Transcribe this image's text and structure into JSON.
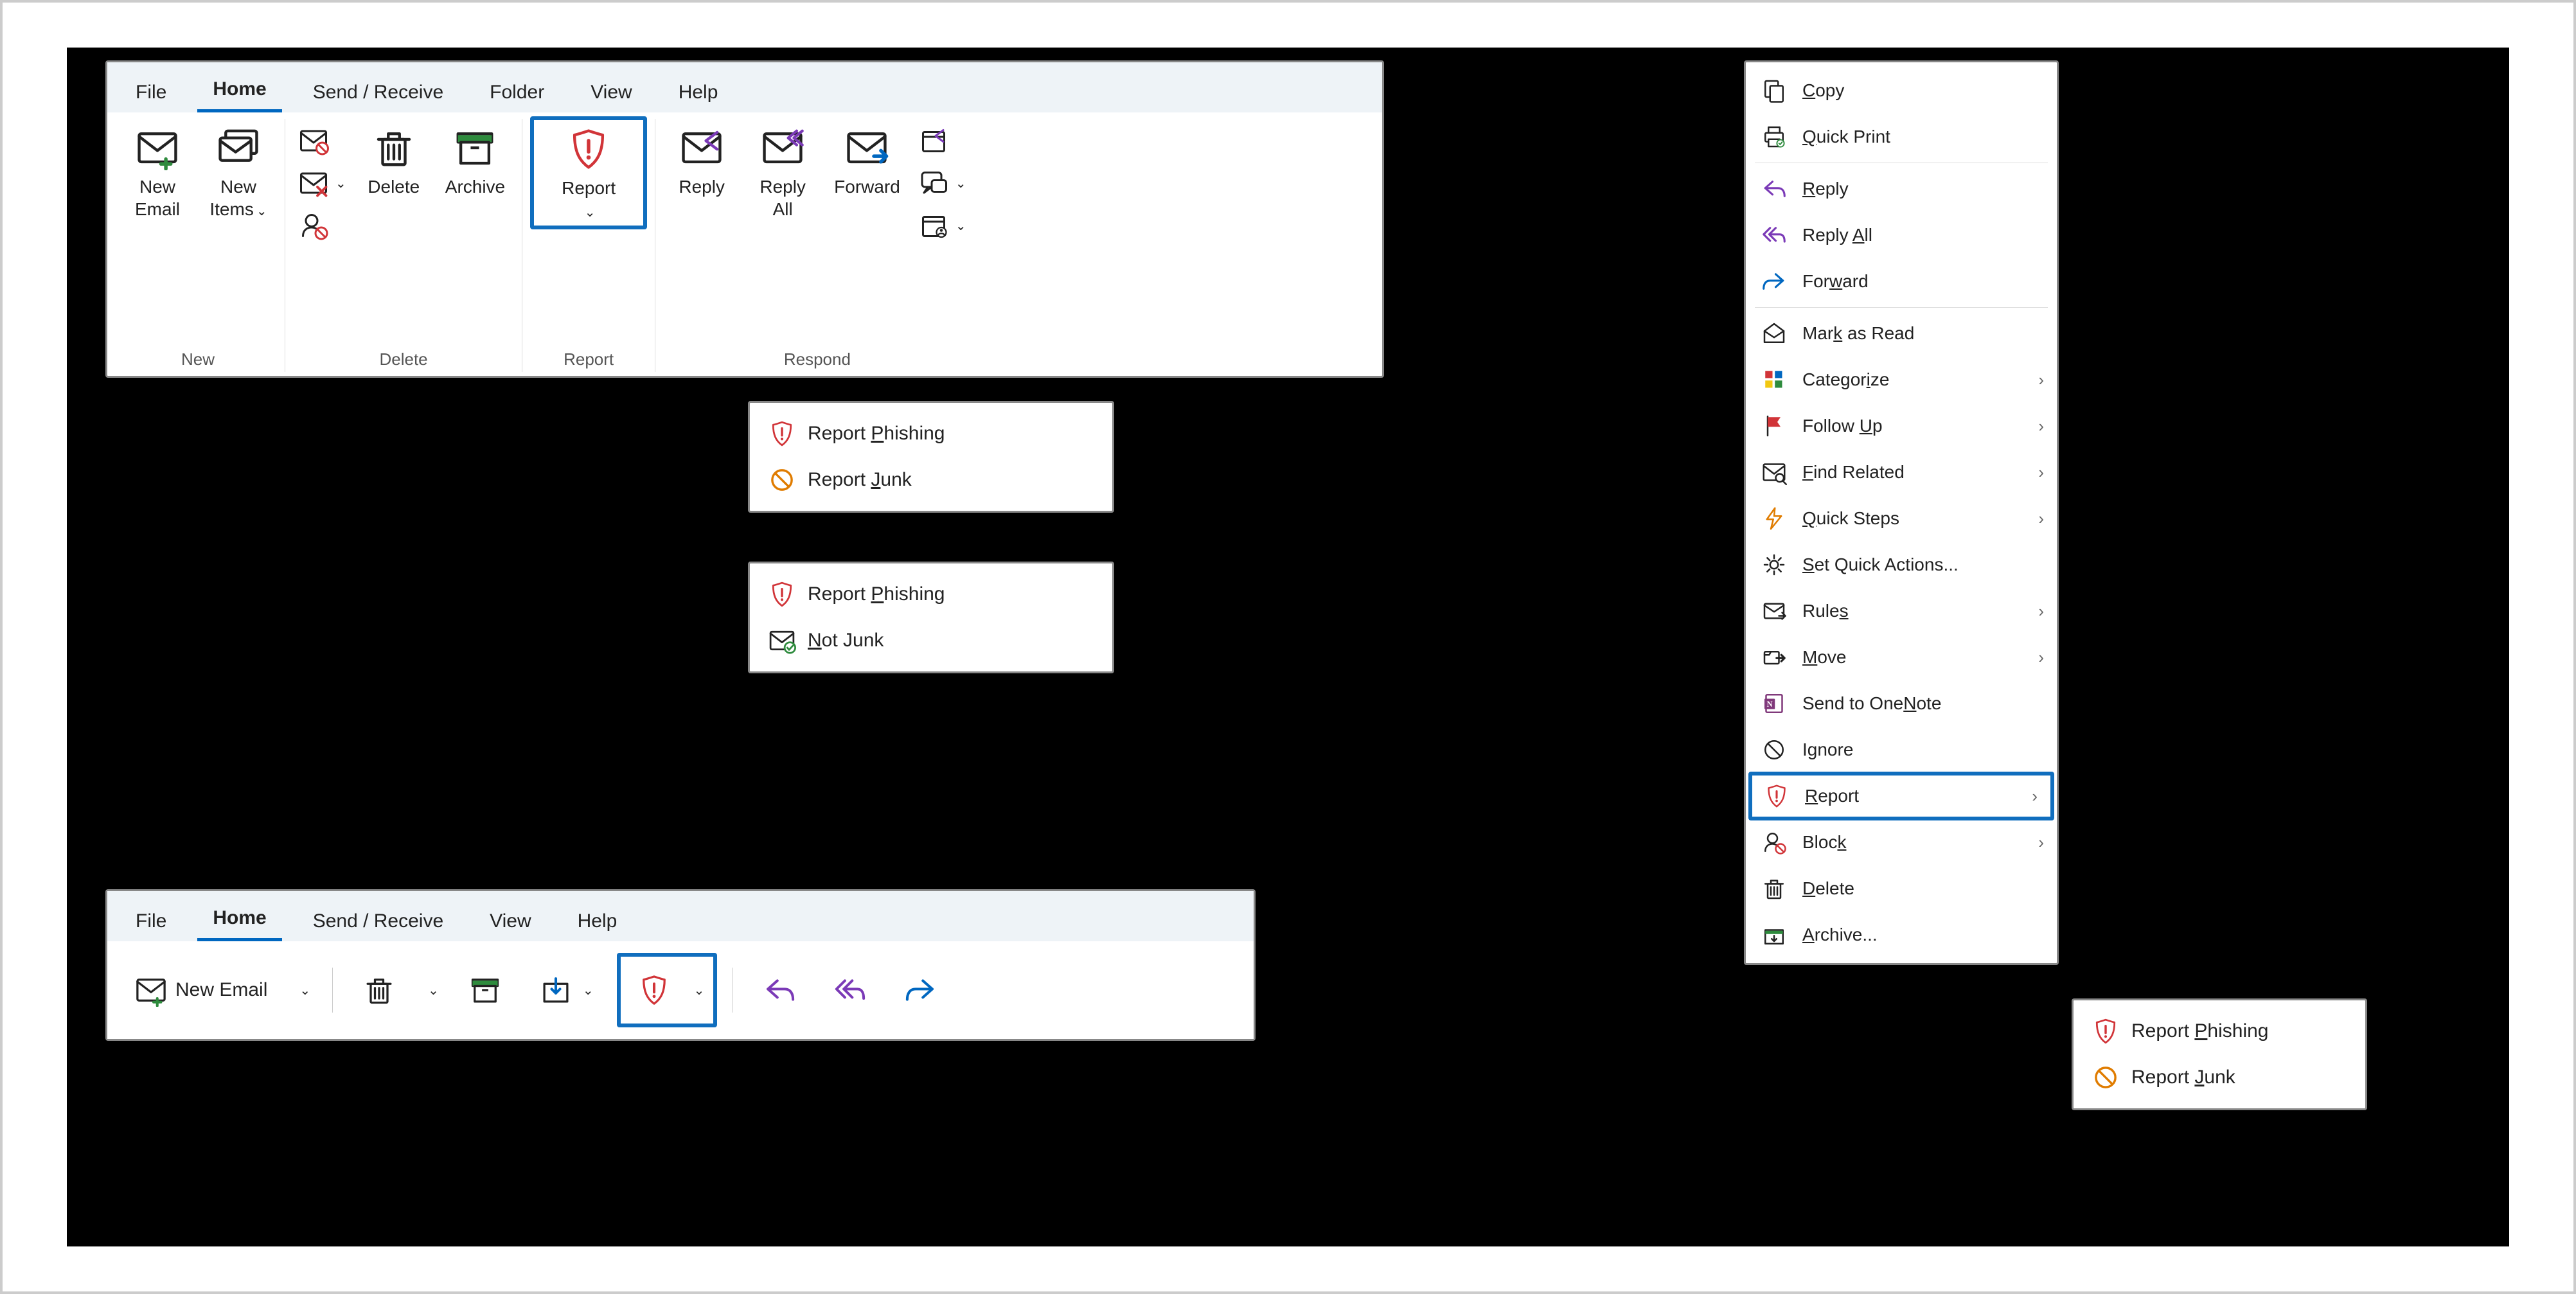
{
  "tabs": {
    "file": "File",
    "home": "Home",
    "send_receive": "Send / Receive",
    "folder": "Folder",
    "view": "View",
    "help": "Help"
  },
  "ribbon": {
    "new_group": "New",
    "new_email": "New\nEmail",
    "new_items": "New\nItems",
    "delete_group": "Delete",
    "delete": "Delete",
    "archive": "Archive",
    "report_group": "Report",
    "report": "Report",
    "respond_group": "Respond",
    "reply": "Reply",
    "reply_all": "Reply\nAll",
    "forward": "Forward"
  },
  "report_menu": {
    "phishing_pre": "Report ",
    "phishing_u": "P",
    "phishing_post": "hishing",
    "junk_pre": "Report ",
    "junk_u": "J",
    "junk_post": "unk",
    "notjunk_u": "N",
    "notjunk_post": "ot Junk"
  },
  "simple": {
    "new_email": "New Email"
  },
  "ctx": {
    "copy_u": "C",
    "copy_post": "opy",
    "quick_print_u": "Q",
    "quick_print_post": "uick Print",
    "reply_u": "R",
    "reply_post": "eply",
    "reply_all_pre": "Reply ",
    "reply_all_u": "A",
    "reply_all_post": "ll",
    "forward_pre": "For",
    "forward_u": "w",
    "forward_post": "ard",
    "mark_read_pre": "Mar",
    "mark_read_u": "k",
    "mark_read_post": " as Read",
    "categorize_pre": "Categor",
    "categorize_u": "i",
    "categorize_post": "ze",
    "follow_up_pre": "Follow ",
    "follow_up_u": "U",
    "follow_up_post": "p",
    "find_related_u": "F",
    "find_related_post": "ind Related",
    "quick_steps_u": "Q",
    "quick_steps_post": "uick Steps",
    "set_quick_actions_u": "S",
    "set_quick_actions_post": "et Quick Actions...",
    "rules_pre": "Rule",
    "rules_u": "s",
    "move_u": "M",
    "move_post": "ove",
    "onenote_pre": "Send to One",
    "onenote_u": "N",
    "onenote_post": "ote",
    "ignore_pre": "I",
    "ignore_u": "g",
    "ignore_post": "nore",
    "report_u": "R",
    "report_post": "eport",
    "block_pre": "Bloc",
    "block_u": "k",
    "delete_u": "D",
    "delete_post": "elete",
    "archive_u": "A",
    "archive_post": "rchive..."
  }
}
